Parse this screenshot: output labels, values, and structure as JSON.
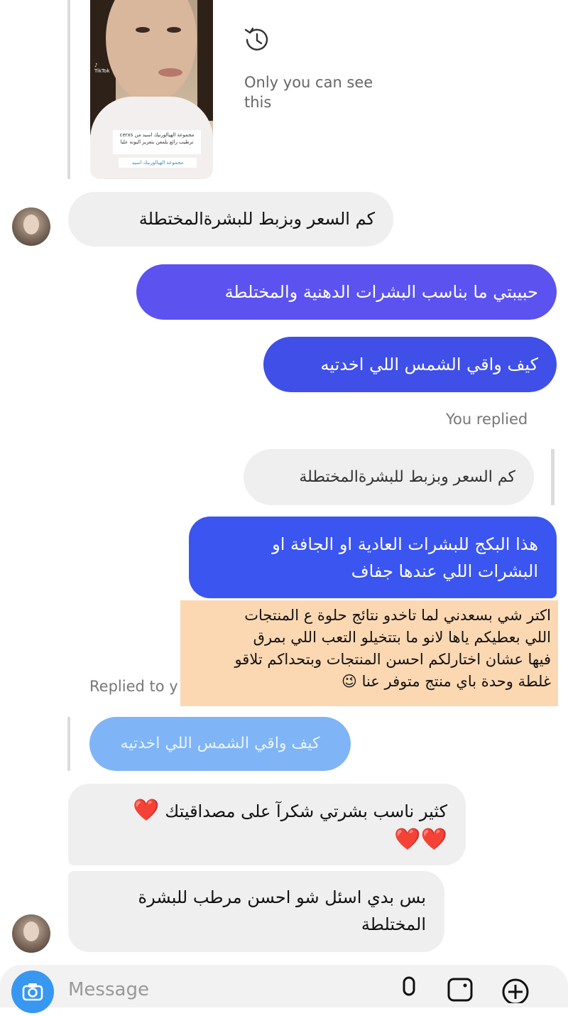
{
  "shared_post": {
    "platform_label": "TikTok",
    "caption": "مجموعة الهيالورنيك اسيد من cerxs ترطيب رائع يلمعن بتعزيز اليونة عليا",
    "link_text": "مجموعة الهيالورنيك اسيد",
    "visibility_note": "Only you can see this"
  },
  "messages": [
    {
      "from": "them",
      "text": "كم السعر وبزبط للبشرةالمختطلة"
    },
    {
      "from": "me",
      "text": "حبيبتي ما بناسب البشرات الدهنية والمختلطة"
    },
    {
      "from": "me",
      "text": "كيف واقي الشمس اللي اخدتيه"
    }
  ],
  "reply_block_1": {
    "label": "You replied",
    "quoted_text": "كم السعر وبزبط للبشرةالمختطلة",
    "reply_line1": "هذا البكج للبشرات العادية او الجافة او",
    "reply_line2": "البشرات اللي عندها جفاف"
  },
  "overlay_note": {
    "line1": "اكتر شي بسعدني لما تاخدو نتائج حلوة ع المنتجات",
    "line2": "اللي بعطيكم ياها لانو ما بتتخيلو التعب اللي بمرق",
    "line3": "فيها عشان اختارلكم احسن المنتجات وبتحداكم تلاقو",
    "line4": "غلطة وحدة باي منتج متوفر عنا 😉"
  },
  "reply_block_2": {
    "label_partial": "Replied to y",
    "quoted_text": "كيف واقي الشمس اللي اخدتيه"
  },
  "incoming_after": {
    "msg1_text": "كثير ناسب بشرتي شكرآ على مصداقيتك",
    "msg1_hearts_line1": "❤️",
    "msg1_hearts_line2": "❤️❤️",
    "msg2_line1": "بس بدي اسئل شو احسن مرطب للبشرة",
    "msg2_line2": "المختلطة"
  },
  "composer": {
    "placeholder": "Message",
    "icons": [
      "camera-icon",
      "microphone-icon",
      "gallery-icon",
      "add-icon"
    ]
  },
  "colors": {
    "outgoing_purple": "#5b52f0",
    "outgoing_indigo": "#3f4fe8",
    "outgoing_blue": "#3a55f0",
    "incoming_gray": "#efefef",
    "accent_blue": "#3897f0",
    "note_bg": "#fbd8b2"
  }
}
